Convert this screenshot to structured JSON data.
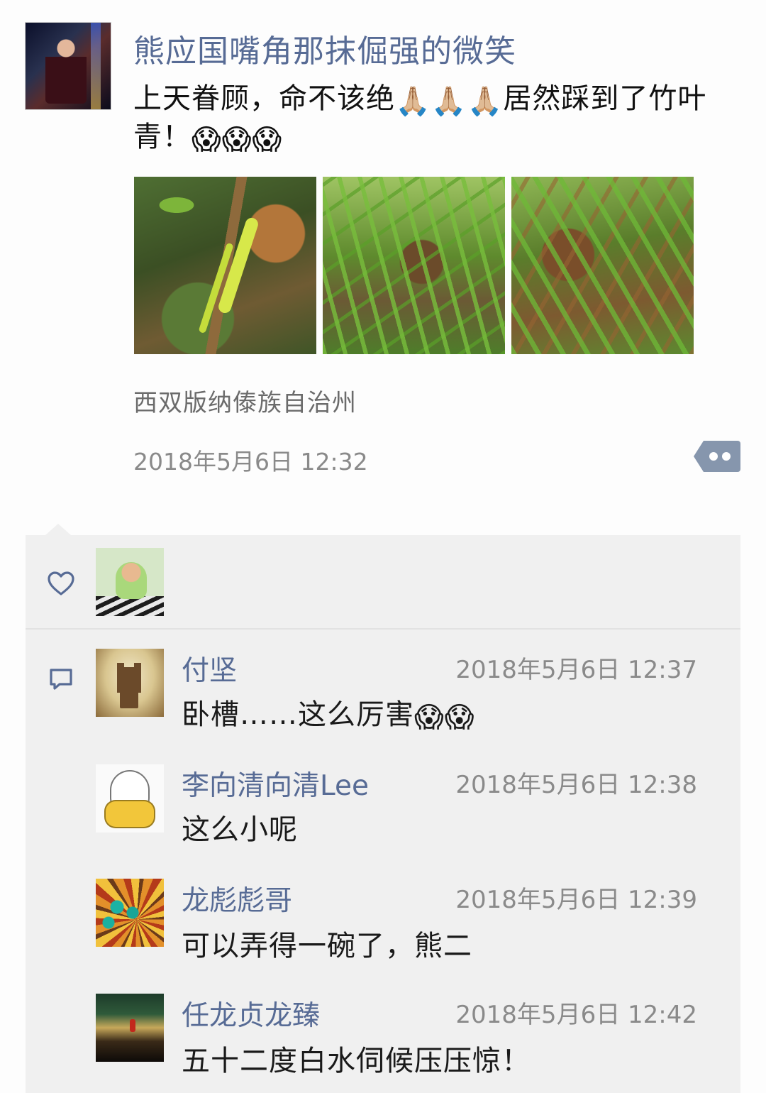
{
  "post": {
    "author": "熊应国嘴角那抹倔强的微笑",
    "text_part1": "上天眷顾，命不该绝",
    "text_emoji1": "🙏🏼🙏🏼🙏🏼",
    "text_part2": "居然踩到了竹叶青！",
    "text_emoji2": "😱😱😱",
    "location": "西双版纳傣族自治州",
    "time": "2018年5月6日 12:32"
  },
  "icons": {
    "heart": "heart-icon",
    "comment": "comment-bubble-icon",
    "more": "more-dots-icon"
  },
  "comments": [
    {
      "name": "付坚",
      "time": "2018年5月6日 12:37",
      "text": "卧槽……这么厉害",
      "emoji": "😱😱"
    },
    {
      "name": "李向清向清Lee",
      "time": "2018年5月6日 12:38",
      "text": "这么小呢",
      "emoji": ""
    },
    {
      "name": "龙彪彪哥",
      "time": "2018年5月6日 12:39",
      "text": "可以弄得一碗了，熊二",
      "emoji": ""
    },
    {
      "name": "任龙贞龙臻",
      "time": "2018年5月6日 12:42",
      "text": "五十二度白水伺候压压惊！",
      "emoji": ""
    }
  ],
  "colors": {
    "link_blue": "#576b95",
    "panel_bg": "#f0f0f0",
    "secondary_text": "#8a8a8a"
  }
}
